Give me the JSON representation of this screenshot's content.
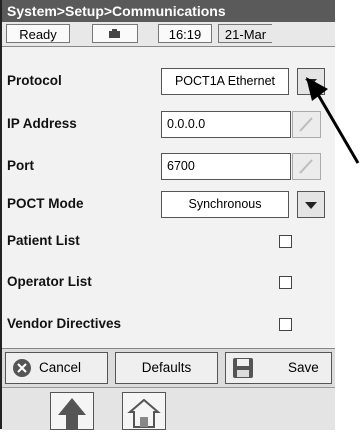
{
  "breadcrumb": "System>Setup>Communications",
  "status": {
    "state": "Ready",
    "time": "16:19",
    "date": "21-Mar"
  },
  "rows": [
    {
      "label": "Protocol",
      "value": "POCT1A Ethernet"
    },
    {
      "label": "IP Address",
      "value": "0.0.0.0"
    },
    {
      "label": "Port",
      "value": "6700"
    },
    {
      "label": "POCT Mode",
      "value": "Synchronous"
    },
    {
      "label": "Patient List",
      "checked": false
    },
    {
      "label": "Operator List",
      "checked": false
    },
    {
      "label": "Vendor Directives",
      "checked": false
    }
  ],
  "buttons": {
    "cancel": "Cancel",
    "defaults": "Defaults",
    "save": "Save"
  },
  "icons": [
    "battery-icon",
    "cancel-x-icon",
    "floppy-disk-icon",
    "pencil-icon",
    "up-arrow-icon",
    "home-icon",
    "pointer-arrow-icon"
  ]
}
